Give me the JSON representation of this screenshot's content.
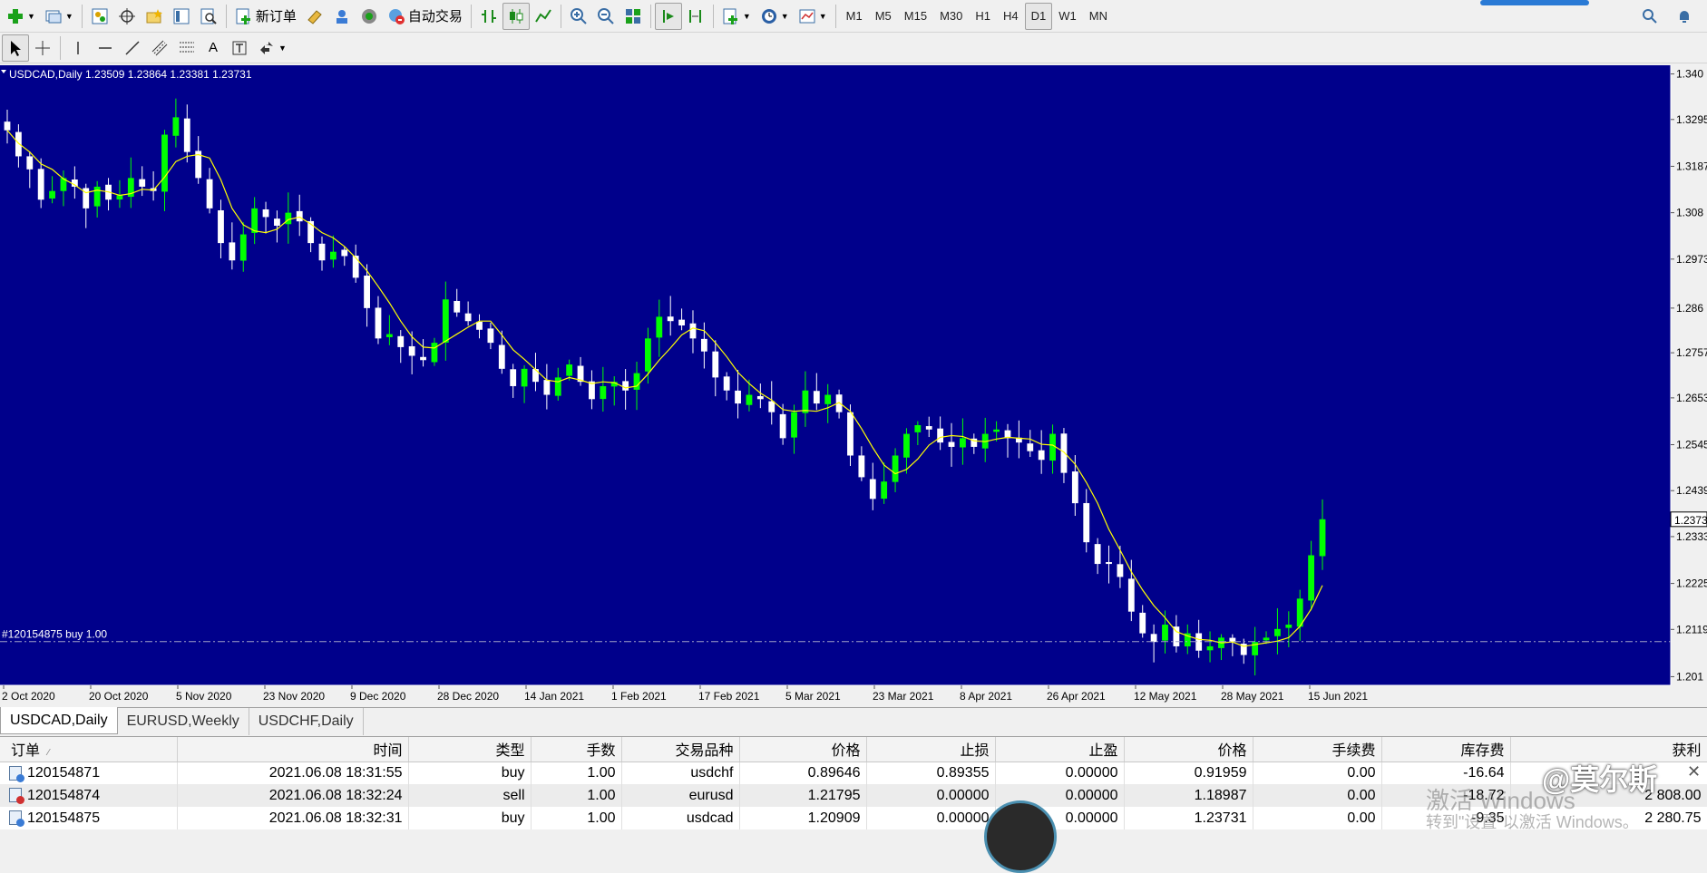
{
  "toolbar1": {
    "new_order_label": "新订单",
    "auto_trade_label": "自动交易",
    "timeframes": [
      "M1",
      "M5",
      "M15",
      "M30",
      "H1",
      "H4",
      "D1",
      "W1",
      "MN"
    ],
    "active_timeframe": "D1"
  },
  "chart": {
    "header": "USDCAD,Daily  1.23509 1.23864 1.23381 1.23731",
    "current_price_label": "1.2373",
    "order_line_label": "#120154875 buy 1.00",
    "colors": {
      "background": "#00008b",
      "bull": "#00ff00",
      "bear": "#ffffff",
      "ma": "#ffff00",
      "axis": "#ffffff"
    }
  },
  "chart_data": {
    "type": "candlestick",
    "title": "USDCAD,Daily",
    "ohlc_header": {
      "open": 1.23509,
      "high": 1.23864,
      "low": 1.23381,
      "close": 1.23731
    },
    "y_ticks": [
      "1.340",
      "1.3295",
      "1.3187",
      "1.308",
      "1.2973",
      "1.286",
      "1.2757",
      "1.2653",
      "1.2545",
      "1.2439",
      "1.2333",
      "1.2225",
      "1.2119",
      "1.201"
    ],
    "ylim": [
      1.199,
      1.342
    ],
    "x_ticks": [
      "2 Oct 2020",
      "20 Oct 2020",
      "5 Nov 2020",
      "23 Nov 2020",
      "9 Dec 2020",
      "28 Dec 2020",
      "14 Jan 2021",
      "1 Feb 2021",
      "17 Feb 2021",
      "5 Mar 2021",
      "23 Mar 2021",
      "8 Apr 2021",
      "26 Apr 2021",
      "12 May 2021",
      "28 May 2021",
      "15 Jun 2021"
    ],
    "order_line_price": 1.20909,
    "close_path": [
      1.327,
      1.321,
      1.318,
      1.311,
      1.313,
      1.316,
      1.314,
      1.309,
      1.314,
      1.311,
      1.312,
      1.316,
      1.314,
      1.313,
      1.326,
      1.33,
      1.322,
      1.316,
      1.309,
      1.301,
      1.297,
      1.303,
      1.309,
      1.307,
      1.305,
      1.308,
      1.306,
      1.301,
      1.297,
      1.299,
      1.298,
      1.293,
      1.286,
      1.279,
      1.28,
      1.277,
      1.275,
      1.274,
      1.278,
      1.288,
      1.285,
      1.283,
      1.281,
      1.278,
      1.272,
      1.268,
      1.272,
      1.269,
      1.266,
      1.27,
      1.273,
      1.269,
      1.265,
      1.268,
      1.269,
      1.267,
      1.271,
      1.279,
      1.284,
      1.283,
      1.282,
      1.279,
      1.276,
      1.27,
      1.267,
      1.264,
      1.266,
      1.265,
      1.262,
      1.256,
      1.262,
      1.267,
      1.264,
      1.266,
      1.262,
      1.252,
      1.247,
      1.242,
      1.246,
      1.252,
      1.257,
      1.259,
      1.258,
      1.255,
      1.254,
      1.256,
      1.254,
      1.257,
      1.258,
      1.256,
      1.255,
      1.253,
      1.251,
      1.257,
      1.248,
      1.241,
      1.232,
      1.227,
      1.227,
      1.224,
      1.216,
      1.211,
      1.209,
      1.213,
      1.208,
      1.211,
      1.207,
      1.208,
      1.21,
      1.209,
      1.206,
      1.209,
      1.21,
      1.212,
      1.213,
      1.219,
      1.229,
      1.2373
    ]
  },
  "tabs": [
    {
      "label": "USDCAD,Daily",
      "active": true
    },
    {
      "label": "EURUSD,Weekly",
      "active": false
    },
    {
      "label": "USDCHF,Daily",
      "active": false
    }
  ],
  "orders": {
    "headers": [
      "订单",
      "时间",
      "类型",
      "手数",
      "交易品种",
      "价格",
      "止损",
      "止盈",
      "价格",
      "手续费",
      "库存费",
      "获利"
    ],
    "rows": [
      [
        "120154871",
        "2021.06.08 18:31:55",
        "buy",
        "1.00",
        "usdchf",
        "0.89646",
        "0.89355",
        "0.00000",
        "0.91959",
        "0.00",
        "-16.64",
        ""
      ],
      [
        "120154874",
        "2021.06.08 18:32:24",
        "sell",
        "1.00",
        "eurusd",
        "1.21795",
        "0.00000",
        "0.00000",
        "1.18987",
        "0.00",
        "-18.72",
        "2 808.00"
      ],
      [
        "120154875",
        "2021.06.08 18:32:31",
        "buy",
        "1.00",
        "usdcad",
        "1.20909",
        "0.00000",
        "0.00000",
        "1.23731",
        "0.00",
        "-9.35",
        "2 280.75"
      ]
    ]
  },
  "watermarks": {
    "activate_line1": "激活 Windows",
    "activate_line2": "转到\"设置\"以激活 Windows。",
    "brand": "@莫尔斯"
  }
}
